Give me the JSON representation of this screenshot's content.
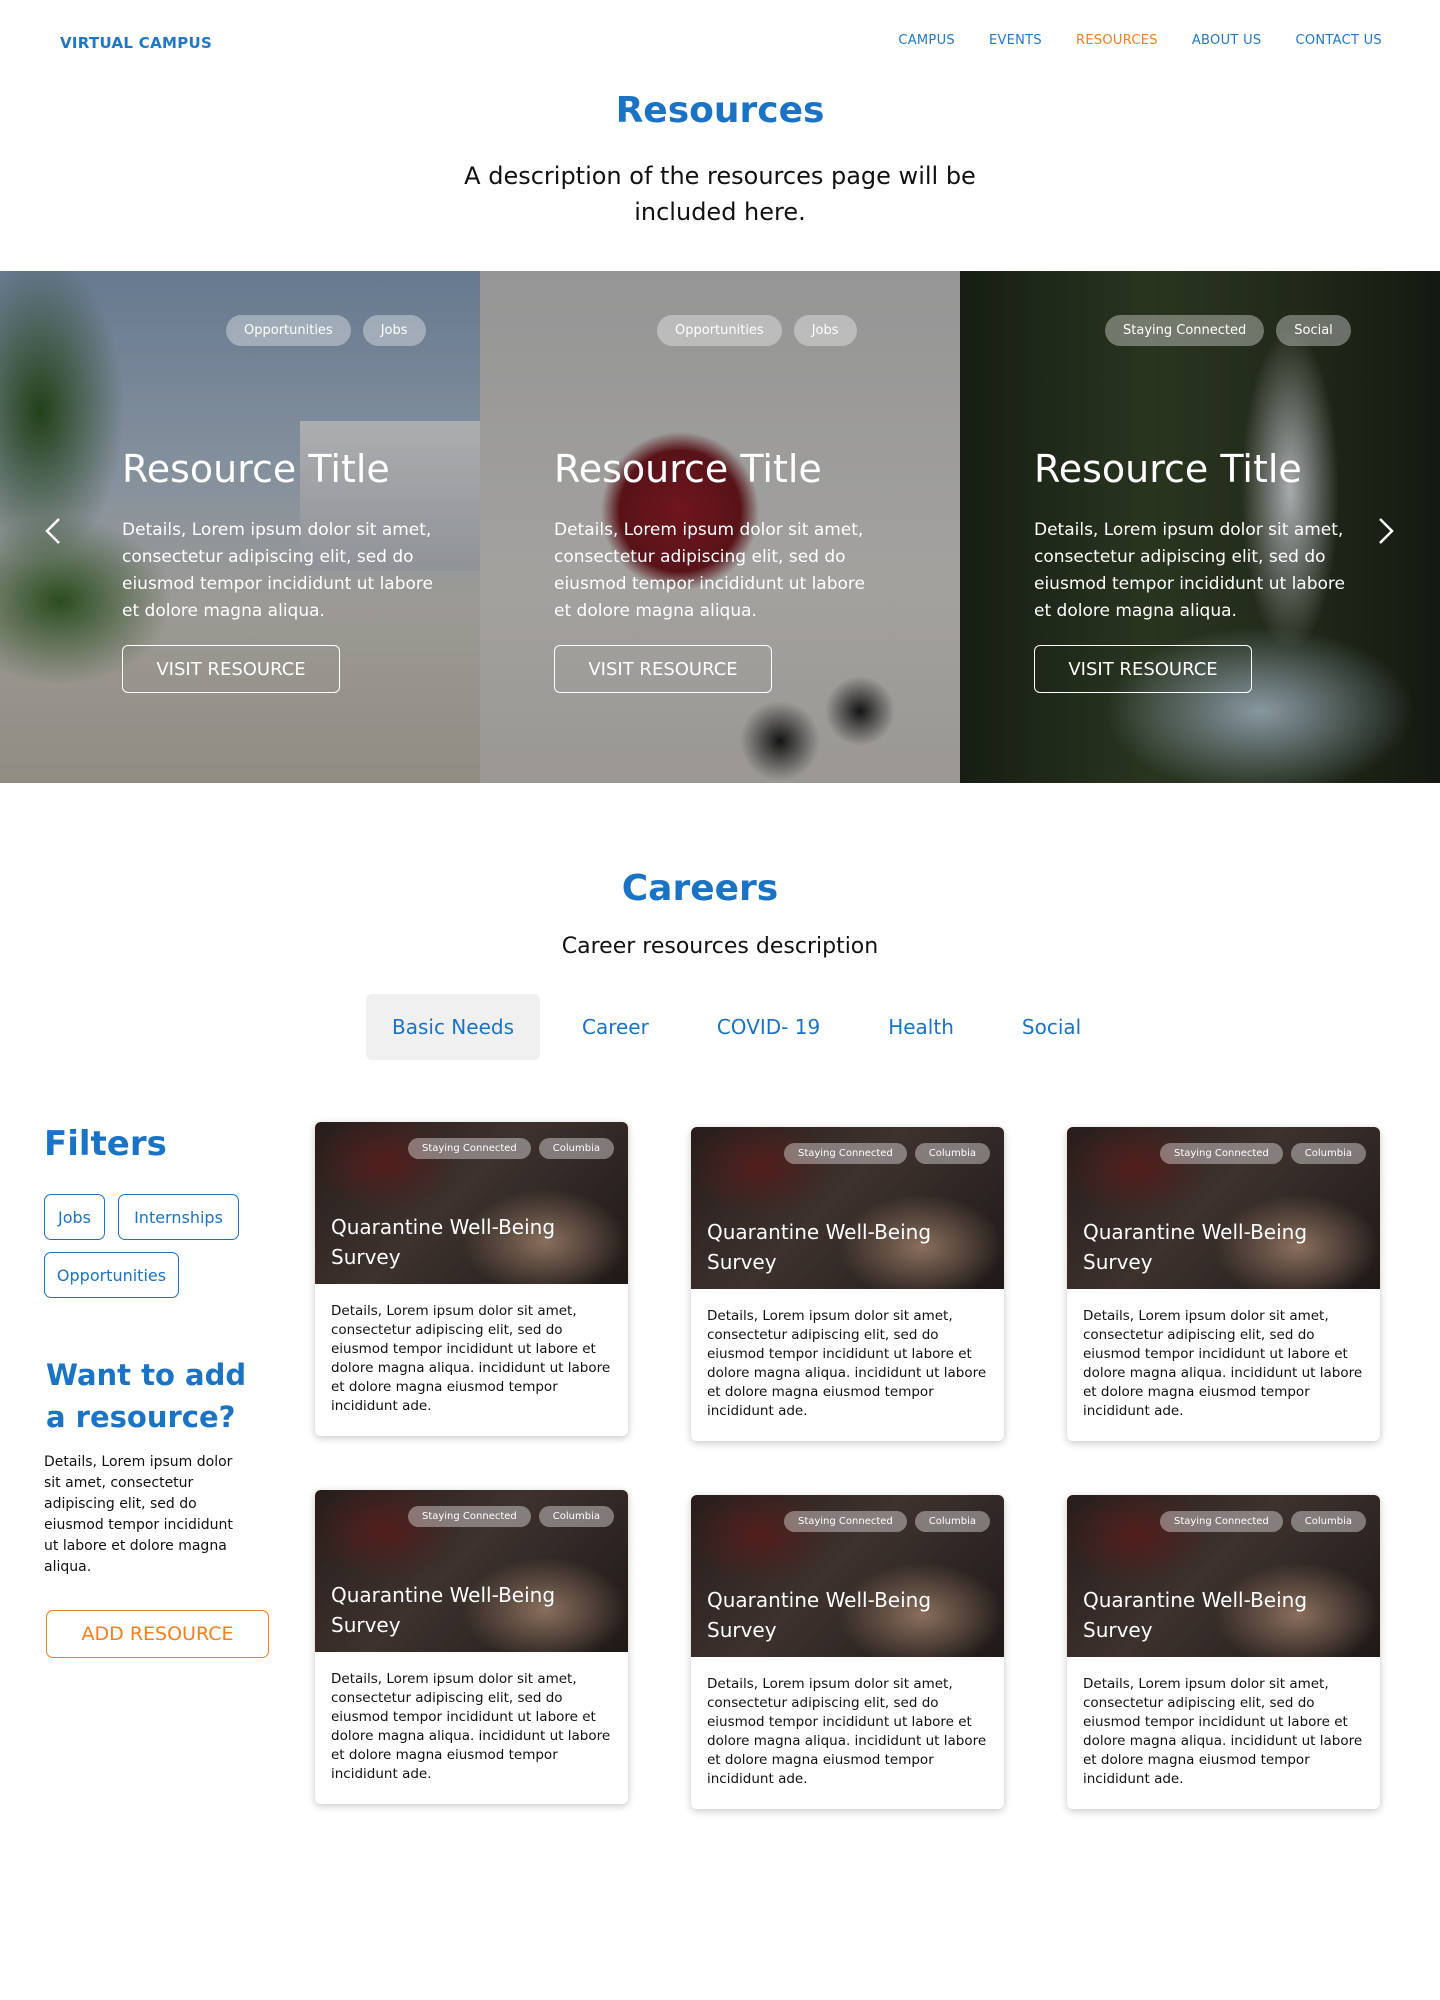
{
  "nav": {
    "logo": "VIRTUAL CAMPUS",
    "links": [
      "CAMPUS",
      "EVENTS",
      "RESOURCES",
      "ABOUT US",
      "CONTACT US"
    ],
    "active_color": "#f08020",
    "link_color": "#1f77c8"
  },
  "hero": {
    "title": "Resources",
    "description": "A description of the resources page will be included here."
  },
  "carousel": {
    "slides": [
      {
        "tags": [
          "Opportunities",
          "Jobs"
        ],
        "title": "Resource Title",
        "text": "Details, Lorem ipsum dolor sit amet, consectetur adipiscing elit, sed do eiusmod tempor incididunt ut labore et dolore magna aliqua.",
        "button": "VISIT RESOURCE"
      },
      {
        "tags": [
          "Opportunities",
          "Jobs"
        ],
        "title": "Resource Title",
        "text": "Details, Lorem ipsum dolor sit amet, consectetur adipiscing elit, sed do eiusmod tempor incididunt ut labore et dolore magna aliqua.",
        "button": "VISIT RESOURCE"
      },
      {
        "tags": [
          "Staying Connected",
          "Social"
        ],
        "title": "Resource Title",
        "text": "Details, Lorem ipsum dolor sit amet, consectetur adipiscing elit, sed do eiusmod tempor incididunt ut labore et dolore magna aliqua.",
        "button": "VISIT RESOURCE"
      }
    ],
    "prev_icon": "chevron-left-icon",
    "next_icon": "chevron-right-icon"
  },
  "careers": {
    "title": "Careers",
    "description": "Career resources description",
    "tabs": [
      "Basic Needs",
      "Career",
      "COVID- 19",
      "Health",
      "Social"
    ]
  },
  "filters": {
    "title": "Filters",
    "chips": [
      "Jobs",
      "Internships",
      "Opportunities"
    ]
  },
  "add_resource": {
    "title": "Want to add a resource?",
    "description": "Details, Lorem ipsum dolor sit amet, consectetur adipiscing elit, sed do eiusmod tempor incididunt ut labore et dolore magna aliqua.",
    "button": "ADD RESOURCE"
  },
  "cards": [
    {
      "tags": [
        "Staying Connected",
        "Columbia"
      ],
      "title": "Quarantine Well-Being Survey",
      "text": "Details, Lorem ipsum dolor sit amet, consectetur adipiscing elit, sed do eiusmod tempor incididunt ut labore et dolore magna aliqua. incididunt ut labore et dolore magna eiusmod tempor incididunt ade."
    },
    {
      "tags": [
        "Staying Connected",
        "Columbia"
      ],
      "title": "Quarantine Well-Being Survey",
      "text": "Details, Lorem ipsum dolor sit amet, consectetur adipiscing elit, sed do eiusmod tempor incididunt ut labore et dolore magna aliqua. incididunt ut labore et dolore magna eiusmod tempor incididunt ade."
    },
    {
      "tags": [
        "Staying Connected",
        "Columbia"
      ],
      "title": "Quarantine Well-Being Survey",
      "text": "Details, Lorem ipsum dolor sit amet, consectetur adipiscing elit, sed do eiusmod tempor incididunt ut labore et dolore magna aliqua. incididunt ut labore et dolore magna eiusmod tempor incididunt ade."
    },
    {
      "tags": [
        "Staying Connected",
        "Columbia"
      ],
      "title": "Quarantine Well-Being Survey",
      "text": "Details, Lorem ipsum dolor sit amet, consectetur adipiscing elit, sed do eiusmod tempor incididunt ut labore et dolore magna aliqua. incididunt ut labore et dolore magna eiusmod tempor incididunt ade."
    },
    {
      "tags": [
        "Staying Connected",
        "Columbia"
      ],
      "title": "Quarantine Well-Being Survey",
      "text": "Details, Lorem ipsum dolor sit amet, consectetur adipiscing elit, sed do eiusmod tempor incididunt ut labore et dolore magna aliqua. incididunt ut labore et dolore magna eiusmod tempor incididunt ade."
    },
    {
      "tags": [
        "Staying Connected",
        "Columbia"
      ],
      "title": "Quarantine Well-Being Survey",
      "text": "Details, Lorem ipsum dolor sit amet, consectetur adipiscing elit, sed do eiusmod tempor incididunt ut labore et dolore magna aliqua. incididunt ut labore et dolore magna eiusmod tempor incididunt ade."
    }
  ]
}
